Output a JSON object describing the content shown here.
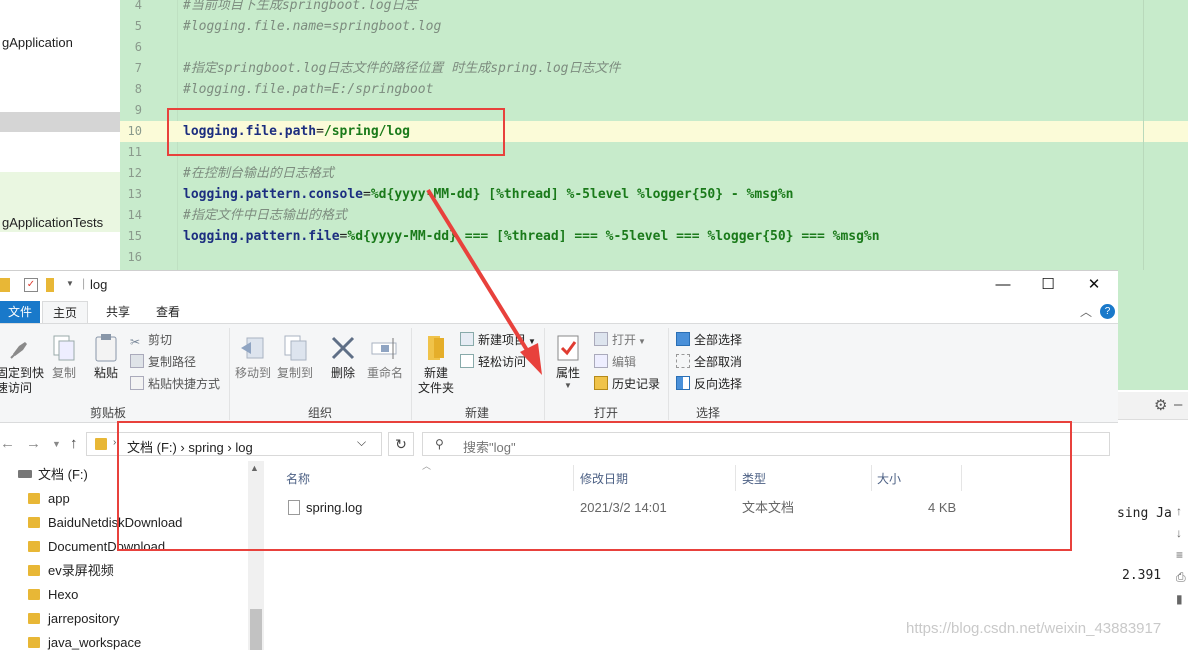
{
  "ide": {
    "project_items": [
      "gApplication",
      "gApplicationTests"
    ],
    "line_numbers": [
      "4",
      "5",
      "6",
      "7",
      "8",
      "9",
      "10",
      "11",
      "12",
      "13",
      "14",
      "15",
      "16"
    ],
    "lines": {
      "l4": "#当前项目下生成springboot.log日志",
      "l5": "#logging.file.name=springboot.log",
      "l7": "#指定springboot.log日志文件的路径位置 时生成spring.log日志文件",
      "l8": "#logging.file.path=E:/springboot",
      "l10_key": "logging.file.path",
      "l10_eq": "=",
      "l10_val": "/spring/log",
      "l12": "#在控制台输出的日志格式",
      "l13_key": "logging.pattern.console",
      "l13_eq": "=",
      "l13_val": "%d{yyyy-MM-dd} [%thread] %-5level %logger{50} - %msg%n",
      "l14": "#指定文件中日志输出的格式",
      "l15_key": "logging.pattern.file",
      "l15_eq": "=",
      "l15_val": "%d{yyyy-MM-dd} === [%thread] === %-5level === %logger{50} === %msg%n"
    },
    "right_text_1": "sing Ja",
    "right_text_2": "2.391"
  },
  "explorer": {
    "title": "log",
    "window_controls": [
      "—",
      "☐",
      "✕"
    ],
    "tabs": {
      "file": "文件",
      "home": "主页",
      "share": "共享",
      "view": "查看"
    },
    "ribbon": {
      "clipboard": {
        "label": "剪贴板",
        "pin": "固定到快\n速访问",
        "copy": "复制",
        "paste": "粘贴",
        "cut": "剪切",
        "copy_path": "复制路径",
        "paste_shortcut": "粘贴快捷方式"
      },
      "organize": {
        "label": "组织",
        "move_to": "移动到",
        "copy_to": "复制到",
        "delete": "删除",
        "rename": "重命名"
      },
      "new": {
        "label": "新建",
        "new_folder": "新建\n文件夹",
        "new_item": "新建项目",
        "easy_access": "轻松访问"
      },
      "open": {
        "label": "打开",
        "properties": "属性",
        "open": "打开",
        "edit": "编辑",
        "history": "历史记录"
      },
      "select": {
        "label": "选择",
        "select_all": "全部选择",
        "select_none": "全部取消",
        "invert": "反向选择"
      }
    },
    "breadcrumb": "文档 (F:)  ›  spring  ›  log",
    "search_placeholder": "搜索\"log\"",
    "tree": [
      "文档 (F:)",
      "app",
      "BaiduNetdiskDownload",
      "DocumentDownload",
      "ev录屏视频",
      "Hexo",
      "jarrepository",
      "java_workspace"
    ],
    "columns": {
      "name": "名称",
      "date": "修改日期",
      "type": "类型",
      "size": "大小"
    },
    "files": [
      {
        "name": "spring.log",
        "date": "2021/3/2 14:01",
        "type": "文本文档",
        "size": "4 KB"
      }
    ]
  },
  "watermark": "https://blog.csdn.net/weixin_43883917",
  "colors": {
    "annotation": "#e8413c",
    "file_tab": "#1979ca",
    "editor_bg": "#c7ebcb"
  }
}
